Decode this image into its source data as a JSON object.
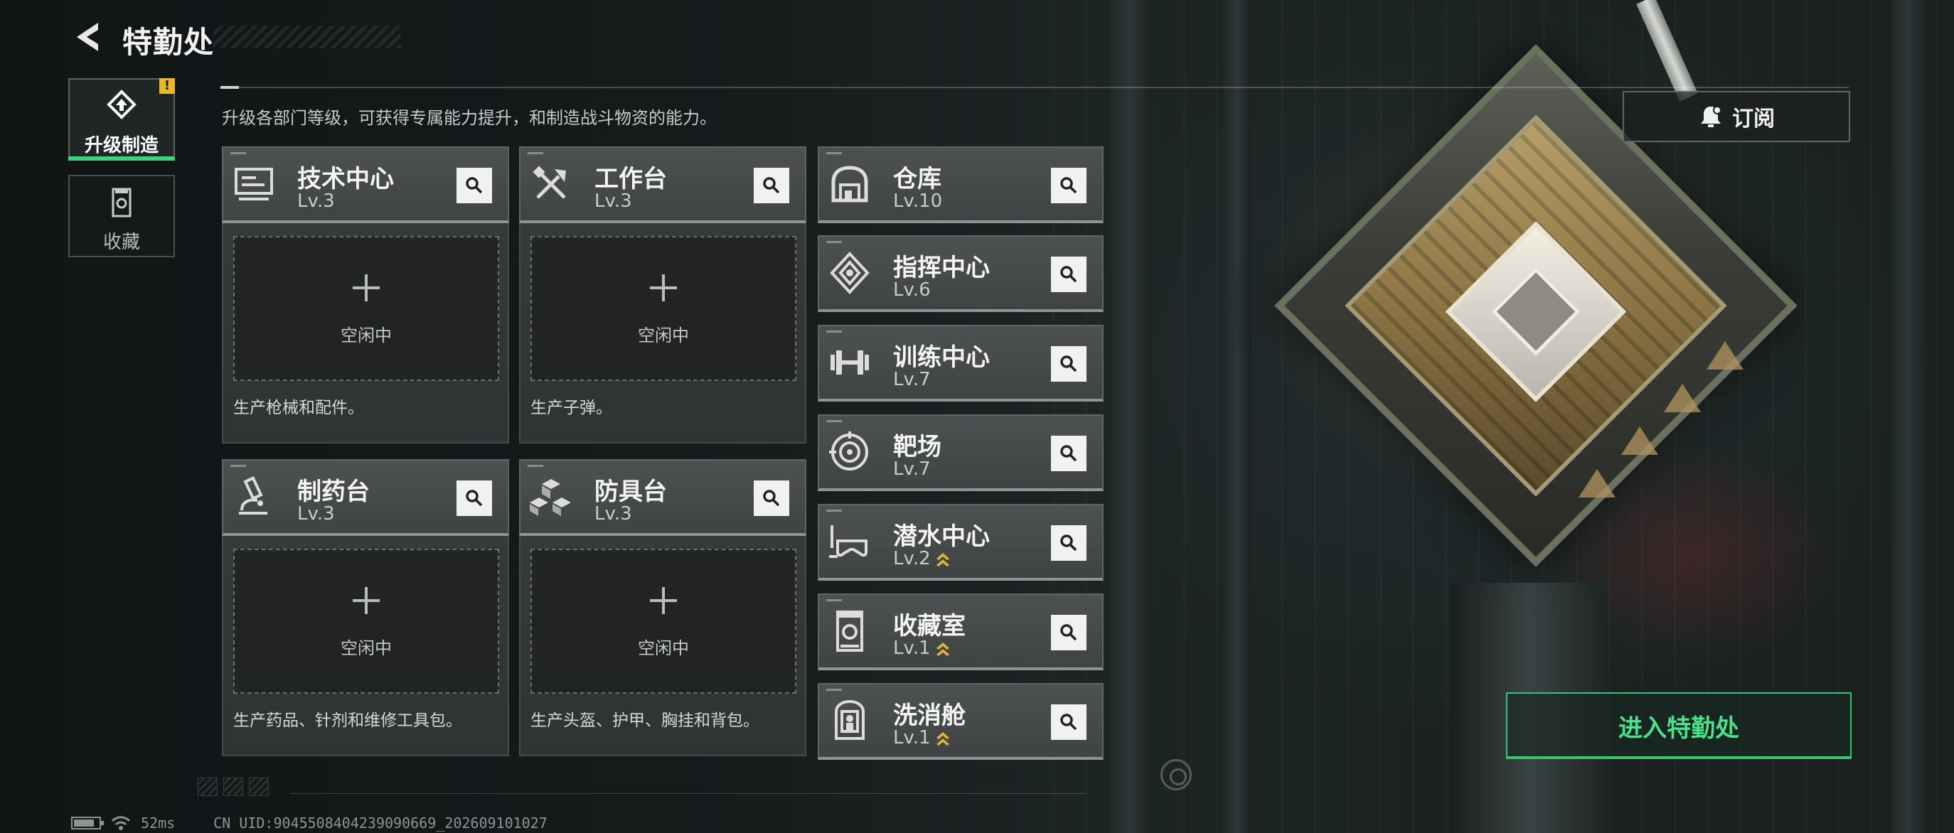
{
  "header": {
    "title": "特勤处"
  },
  "sidebar": {
    "tabs": [
      {
        "label": "升级制造",
        "active": true,
        "alert": "!"
      },
      {
        "label": "收藏",
        "active": false
      }
    ]
  },
  "hint": "升级各部门等级，可获得专属能力提升，和制造战斗物资的能力。",
  "subscribe_label": "订阅",
  "workshops": [
    {
      "name": "技术中心",
      "level": "Lv.3",
      "icon": "monitor-icon",
      "slot_status": "空闲中",
      "description": "生产枪械和配件。"
    },
    {
      "name": "工作台",
      "level": "Lv.3",
      "icon": "tools-icon",
      "slot_status": "空闲中",
      "description": "生产子弹。"
    },
    {
      "name": "制药台",
      "level": "Lv.3",
      "icon": "microscope-icon",
      "slot_status": "空闲中",
      "description": "生产药品、针剂和维修工具包。"
    },
    {
      "name": "防具台",
      "level": "Lv.3",
      "icon": "armor-blocks-icon",
      "slot_status": "空闲中",
      "description": "生产头盔、护甲、胸挂和背包。"
    }
  ],
  "facilities": [
    {
      "name": "仓库",
      "level": "Lv.10",
      "icon": "warehouse-icon",
      "upgradable": false
    },
    {
      "name": "指挥中心",
      "level": "Lv.6",
      "icon": "command-icon",
      "upgradable": false
    },
    {
      "name": "训练中心",
      "level": "Lv.7",
      "icon": "dumbbell-icon",
      "upgradable": false
    },
    {
      "name": "靶场",
      "level": "Lv.7",
      "icon": "target-icon",
      "upgradable": false
    },
    {
      "name": "潜水中心",
      "level": "Lv.2",
      "icon": "diving-mask-icon",
      "upgradable": true
    },
    {
      "name": "收藏室",
      "level": "Lv.1",
      "icon": "collection-icon",
      "upgradable": true
    },
    {
      "name": "洗消舱",
      "level": "Lv.1",
      "icon": "decon-pod-icon",
      "upgradable": true
    }
  ],
  "enter_label": "进入特勤处",
  "status": {
    "ping": "52ms",
    "uid": "CN UID:904550840423909066​9_202609101027"
  },
  "colors": {
    "accent_green": "#3bd37a",
    "upgrade_gold": "#e0b23a",
    "alert_yellow": "#e7b92f"
  }
}
